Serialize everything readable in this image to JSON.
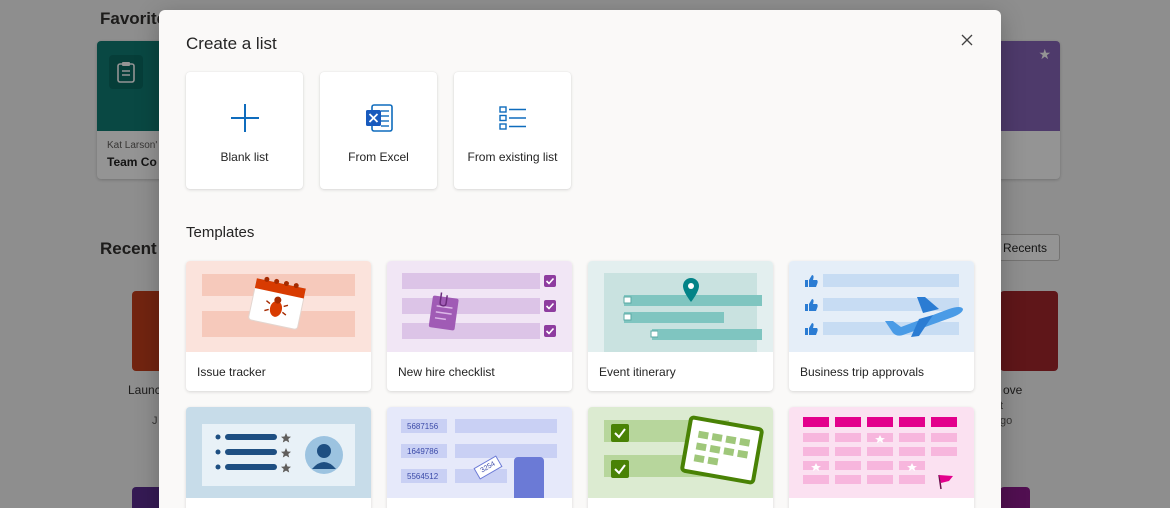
{
  "background": {
    "favorites_heading": "Favorite",
    "recent_heading": "Recent",
    "favorite_card": {
      "owner": "Kat Larson'",
      "title": "Team Co"
    },
    "recents_button": "Recents",
    "recent_items": [
      "Launc",
      "J",
      "ove",
      "t",
      "go"
    ]
  },
  "modal": {
    "title": "Create a list",
    "close_icon": "close-icon",
    "create_options": [
      {
        "label": "Blank list",
        "icon": "plus-icon"
      },
      {
        "label": "From Excel",
        "icon": "excel-icon"
      },
      {
        "label": "From existing list",
        "icon": "list-icon"
      }
    ],
    "templates_heading": "Templates",
    "templates": [
      {
        "label": "Issue tracker"
      },
      {
        "label": "New hire checklist"
      },
      {
        "label": "Event itinerary"
      },
      {
        "label": "Business trip approvals"
      },
      {
        "label": ""
      },
      {
        "label": ""
      },
      {
        "label": ""
      },
      {
        "label": ""
      }
    ],
    "sample_numbers": [
      "5687156",
      "1649786",
      "5564512",
      "3254"
    ]
  },
  "colors": {
    "accent": "#0f6cbd",
    "excel_blue": "#185abd",
    "issue_bg": "#fbe3dc",
    "checklist_bg": "#f1e6f5",
    "event_bg": "#e3efef",
    "trip_bg": "#e5eef8"
  }
}
